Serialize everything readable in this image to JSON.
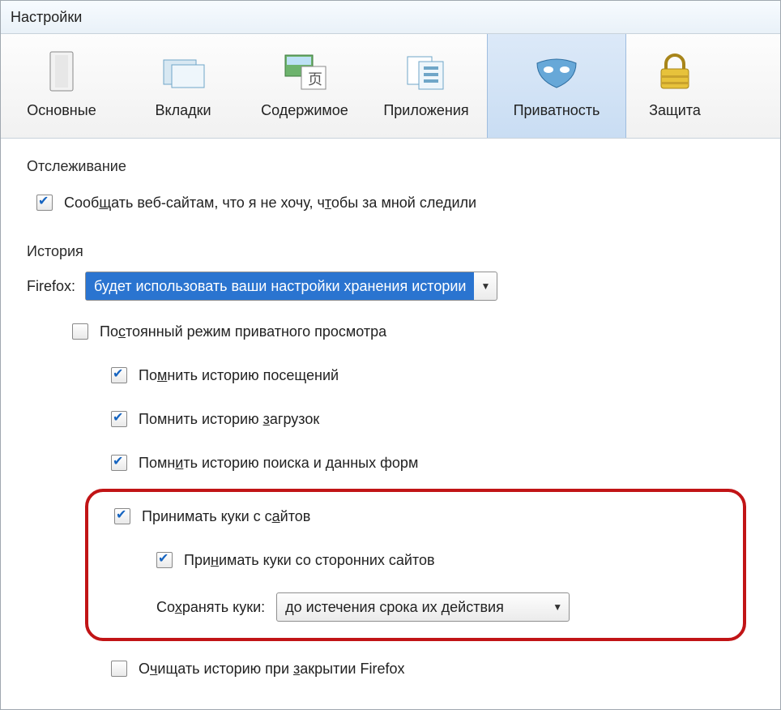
{
  "window_title": "Настройки",
  "tabs": [
    {
      "label": "Основные"
    },
    {
      "label": "Вкладки"
    },
    {
      "label": "Содержимое"
    },
    {
      "label": "Приложения"
    },
    {
      "label": "Приватность"
    },
    {
      "label": "Защита"
    }
  ],
  "tracking": {
    "section": "Отслеживание",
    "do_not_track_before": "Сооб",
    "do_not_track_u": "щ",
    "do_not_track_mid": "ать веб-сайтам, что я не хочу, ч",
    "do_not_track_u2": "т",
    "do_not_track_after": "обы за мной следили",
    "checked": true
  },
  "history": {
    "section": "История",
    "firefox_label": "Firefox:",
    "mode_value": "будет использовать ваши настройки хранения истории",
    "options": {
      "permanent_private": {
        "label_1": "По",
        "label_u": "с",
        "label_2": "тоянный режим приватного просмотра",
        "checked": false
      },
      "remember_browsing": {
        "label_1": "По",
        "label_u": "м",
        "label_2": "нить историю посещений",
        "checked": true
      },
      "remember_downloads": {
        "label_1": "Помнить историю ",
        "label_u": "з",
        "label_2": "агрузок",
        "checked": true
      },
      "remember_search": {
        "label_1": "Помн",
        "label_u": "и",
        "label_2": "ть историю поиска и данных форм",
        "checked": true
      },
      "accept_cookies": {
        "label_1": "Принимать куки с с",
        "label_u": "а",
        "label_2": "йтов",
        "checked": true
      },
      "accept_third_party": {
        "label_1": "При",
        "label_u": "н",
        "label_2": "имать куки со сторонних сайтов",
        "checked": true
      },
      "keep_cookies_label_1": "Со",
      "keep_cookies_label_u": "х",
      "keep_cookies_label_2": "ранять куки:",
      "keep_cookies_value": "до истечения срока их действия",
      "clear_on_close": {
        "label_1": "О",
        "label_u": "ч",
        "label_2": "ищать историю при ",
        "label_u2": "з",
        "label_3": "акрытии Firefox",
        "checked": false
      }
    }
  }
}
